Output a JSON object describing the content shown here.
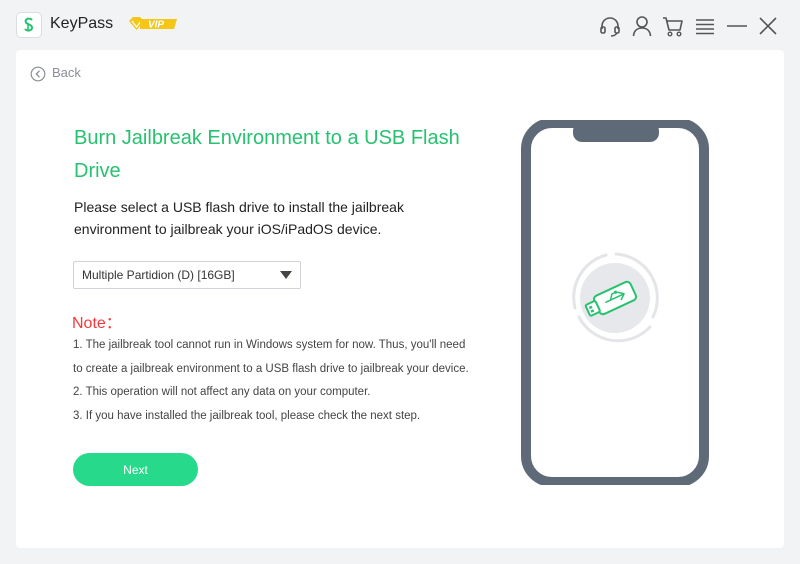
{
  "app": {
    "name": "KeyPass",
    "vip_label": "VIP"
  },
  "window_controls": [
    "headset-icon",
    "user-icon",
    "cart-icon",
    "menu-icon",
    "minimize-icon",
    "close-icon"
  ],
  "nav": {
    "back_label": "Back"
  },
  "content": {
    "title": "Burn Jailbreak Environment to a USB Flash Drive",
    "description": "Please select a USB flash drive to install the jailbreak environment to jailbreak your iOS/iPadOS device.",
    "usb_select": {
      "value": "Multiple Partidion (D) [16GB]"
    },
    "note_title": "Note：",
    "notes": [
      "1. The jailbreak tool cannot run in Windows system for now. Thus, you'll need",
      "to create a jailbreak environment to a USB flash drive to jailbreak your device.",
      "2. This operation will not affect any data on your computer.",
      "3. If you have installed the jailbreak tool, please check the next step."
    ],
    "next_label": "Next"
  },
  "illustration": {
    "icon": "usb-drive-icon"
  },
  "colors": {
    "accent_green": "#27c26f",
    "button_green": "#27d98a",
    "note_red": "#f5383d",
    "phone_frame": "#5f6a78",
    "vip_gold": "#f5c518"
  }
}
